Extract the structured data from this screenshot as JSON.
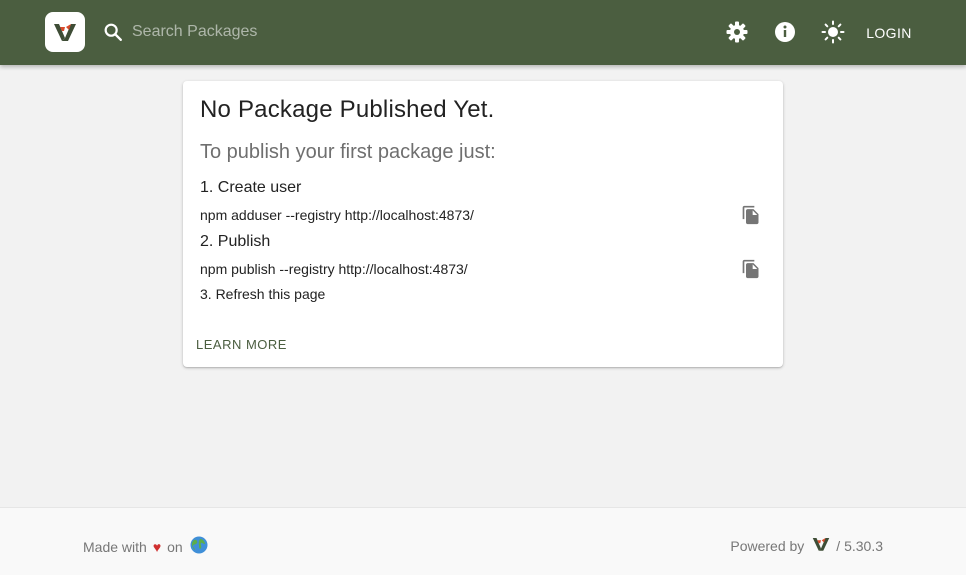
{
  "header": {
    "search_placeholder": "Search Packages",
    "login_label": "LOGIN",
    "icons": [
      "logo-icon",
      "search-icon",
      "gear-icon",
      "info-icon",
      "sun-icon"
    ],
    "colors": {
      "bar": "#4b5e40",
      "logo_red": "#d84a2b",
      "logo_dark": "#3e4d36"
    }
  },
  "card": {
    "title": "No Package Published Yet.",
    "subtitle": "To publish your first package just:",
    "steps": [
      {
        "title": "1. Create user",
        "command": "npm adduser --registry http://localhost:4873/"
      },
      {
        "title": "2. Publish",
        "command": "npm publish --registry http://localhost:4873/"
      },
      {
        "title": "3. Refresh this page"
      }
    ],
    "learn_more_label": "LEARN MORE"
  },
  "footer": {
    "made_with": "Made with",
    "heart": "♥",
    "on": "on",
    "powered_by": "Powered by",
    "version": "/ 5.30.3"
  }
}
